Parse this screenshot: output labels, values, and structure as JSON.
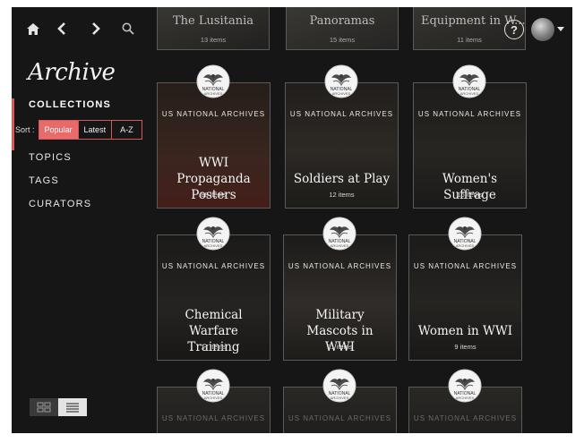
{
  "nav": {
    "help_label": "?"
  },
  "sidebar": {
    "title": "Archive",
    "items": [
      {
        "label": "COLLECTIONS"
      },
      {
        "label": "TOPICS"
      },
      {
        "label": "TAGS"
      },
      {
        "label": "CURATORS"
      }
    ],
    "sort": {
      "label": "Sort :",
      "options": [
        "Popular",
        "Latest",
        "A-Z"
      ],
      "selected": "Popular"
    },
    "view_modes": [
      "grid",
      "list"
    ],
    "selected_view": "grid"
  },
  "top_row": [
    {
      "title": "The Lusitania",
      "count": "13 items"
    },
    {
      "title": "Panoramas",
      "count": "15 items"
    },
    {
      "title": "Equipment in W...",
      "count": "11 items"
    }
  ],
  "collections": [
    {
      "source": "US NATIONAL ARCHIVES",
      "title_lines": [
        "WWI Propaganda",
        "Posters"
      ],
      "count": "88 items"
    },
    {
      "source": "US NATIONAL ARCHIVES",
      "title_lines": [
        "Soldiers at Play"
      ],
      "count": "12 items"
    },
    {
      "source": "US NATIONAL ARCHIVES",
      "title_lines": [
        "Women's Suffrage"
      ],
      "count": "16 items"
    },
    {
      "source": "US NATIONAL ARCHIVES",
      "title_lines": [
        "Chemical Warfare",
        "Training"
      ],
      "count": "17 items"
    },
    {
      "source": "US NATIONAL ARCHIVES",
      "title_lines": [
        "Military Mascots in",
        "WWI"
      ],
      "count": "21 items"
    },
    {
      "source": "US NATIONAL ARCHIVES",
      "title_lines": [
        "Women in WWI"
      ],
      "count": "9 items"
    }
  ],
  "bottom_row": [
    {
      "source": "US NATIONAL ARCHIVES"
    },
    {
      "source": "US NATIONAL ARCHIVES"
    },
    {
      "source": "US NATIONAL ARCHIVES"
    }
  ],
  "seal_text": "NATIONAL ARCHIVES",
  "colors": {
    "accent": "#e86a6a",
    "background": "#161616"
  }
}
